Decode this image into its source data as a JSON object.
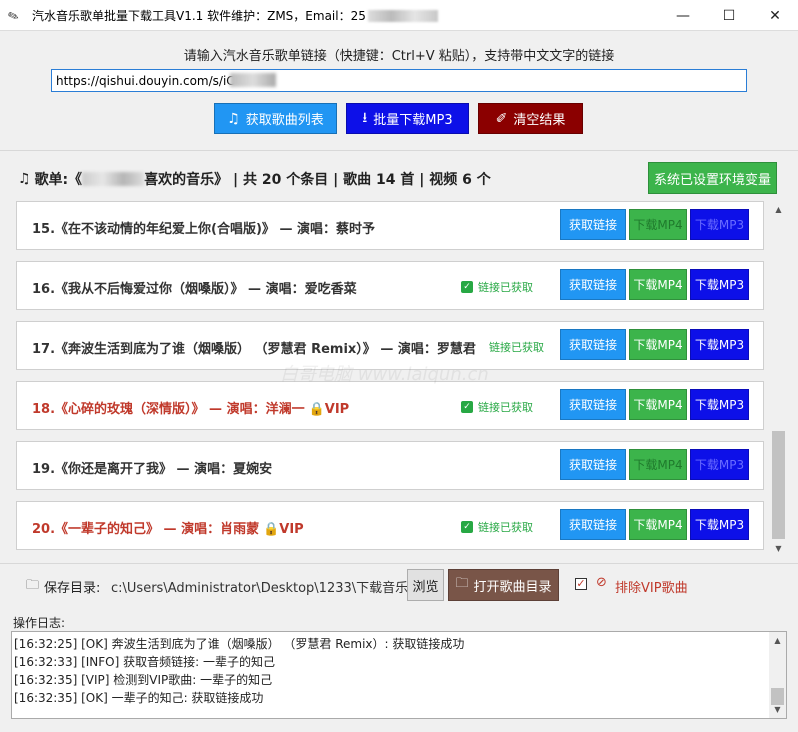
{
  "window": {
    "title": "汽水音乐歌单批量下载工具V1.1    软件维护：ZMS，Email：25",
    "minimize": "—",
    "maximize": "☐",
    "close": "✕"
  },
  "top": {
    "prompt": "请输入汽水音乐歌单链接（快捷键：Ctrl+V 粘贴），支持带中文文字的链接",
    "url_value": "https://qishui.douyin.com/s/iC",
    "buttons": {
      "fetch": "获取歌曲列表",
      "batch_mp3": "批量下载MP3",
      "clear": "清空结果"
    }
  },
  "playlist": {
    "label_prefix": "歌单:《",
    "label_suffix": "喜欢的音乐》 | 共 20 个条目 | 歌曲 14 首 | 视频 6 个",
    "env_button": "系统已设置环境变量"
  },
  "row_buttons": {
    "link": "获取链接",
    "mp4": "下载MP4",
    "mp3": "下载MP3"
  },
  "songs": [
    {
      "text": "15.《在不该动情的年纪爱上你(合唱版)》 — 演唱：蔡时予",
      "vip": false,
      "status": ""
    },
    {
      "text": "16.《我从不后悔爱过你（烟嗓版）》 — 演唱：爱吃香菜",
      "vip": false,
      "status": "链接已获取"
    },
    {
      "text": "17.《奔波生活到底为了谁（烟嗓版） （罗慧君 Remix）》 — 演唱：罗慧君",
      "vip": false,
      "status": "链接已获取"
    },
    {
      "text": "18.《心碎的玫瑰（深情版）》 — 演唱：洋澜一",
      "vip": true,
      "status": "链接已获取"
    },
    {
      "text": "19.《你还是离开了我》 — 演唱：夏婉安",
      "vip": false,
      "status": ""
    },
    {
      "text": "20.《一辈子的知己》 — 演唱：肖雨蒙",
      "vip": true,
      "status": "链接已获取"
    }
  ],
  "vip_tag": "VIP",
  "save": {
    "label": "保存目录:",
    "path": "c:\\Users\\Administrator\\Desktop\\1233\\下载音乐",
    "browse": "浏览",
    "open_dir": "打开歌曲目录",
    "exclude_vip": "排除VIP歌曲",
    "exclude_vip_checked": true
  },
  "log": {
    "label": "操作日志:",
    "lines": [
      "[16:32:25] [OK] 奔波生活到底为了谁（烟嗓版） （罗慧君 Remix）: 获取链接成功",
      "[16:32:33] [INFO] 获取音频链接: 一辈子的知己",
      "[16:32:35] [VIP] 检测到VIP歌曲: 一辈子的知己",
      "[16:32:35] [OK] 一辈子的知己: 获取链接成功"
    ]
  },
  "colors": {
    "blue": "#2196f3",
    "dark_blue": "#0d10e8",
    "green": "#3cb44b",
    "dark_red": "#8b0000",
    "brown": "#795548",
    "vip_red": "#c0392b"
  },
  "watermark": "白哥电脑 www.laiqun.cn"
}
